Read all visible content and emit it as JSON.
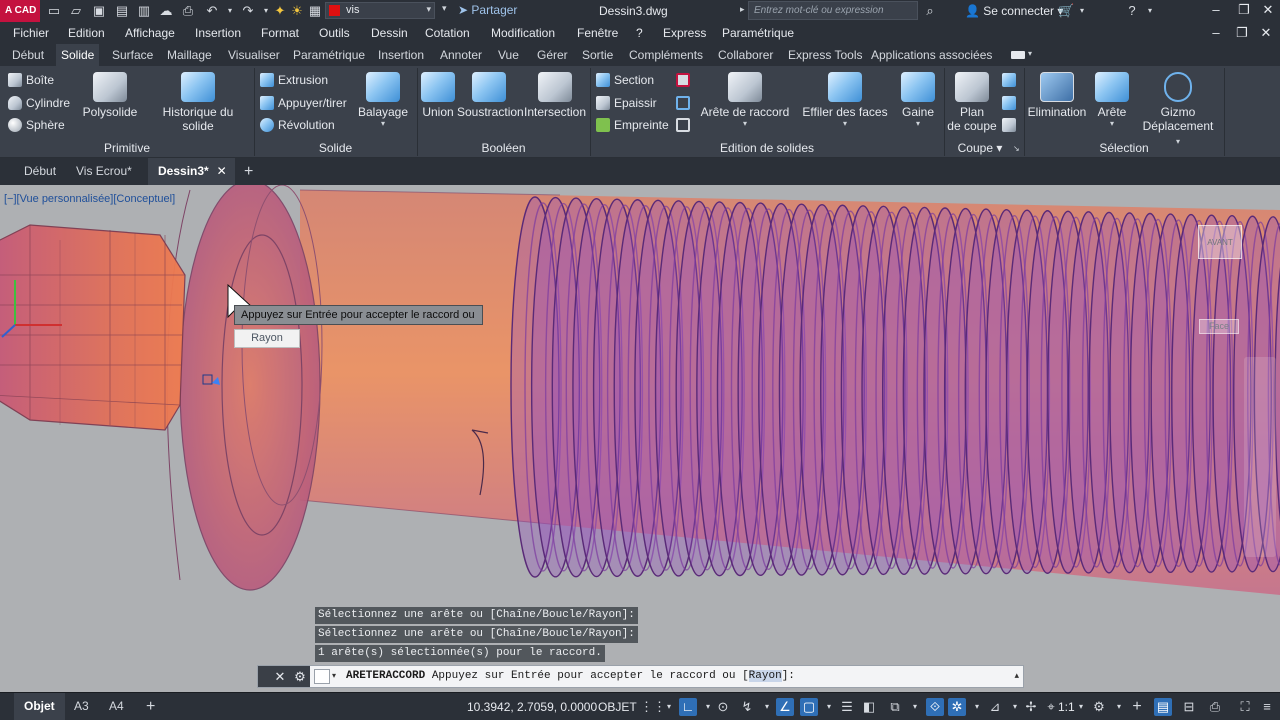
{
  "app": {
    "logo_text": "A CAD",
    "layer_name": "vis",
    "share_label": "Partager",
    "document_title": "Dessin3.dwg",
    "search_placeholder": "Entrez mot-clé ou expression",
    "signin_label": "Se connecter"
  },
  "menus": [
    "Fichier",
    "Edition",
    "Affichage",
    "Insertion",
    "Format",
    "Outils",
    "Dessin",
    "Cotation",
    "Modification",
    "Fenêtre",
    "?",
    "Express",
    "Paramétrique"
  ],
  "ribbon_tabs": [
    "Début",
    "Solide",
    "Surface",
    "Maillage",
    "Visualiser",
    "Paramétrique",
    "Insertion",
    "Annoter",
    "Vue",
    "Gérer",
    "Sortie",
    "Compléments",
    "Collaborer",
    "Express Tools",
    "Applications associées"
  ],
  "ribbon_active_tab": "Solide",
  "ribbon": {
    "primitive": {
      "title": "Primitive",
      "boite": "Boîte",
      "cylindre": "Cylindre",
      "sphere": "Sphère",
      "polysolide": "Polysolide",
      "historique": "Historique du solide"
    },
    "solide": {
      "title": "Solide",
      "extrusion": "Extrusion",
      "appuyer": "Appuyer/tirer",
      "revolution": "Révolution",
      "balayage": "Balayage"
    },
    "booleen": {
      "title": "Booléen",
      "union": "Union",
      "soustraction": "Soustraction",
      "intersection": "Intersection"
    },
    "edition": {
      "title": "Edition de solides",
      "section": "Section",
      "epaissir": "Epaissir",
      "empreinte": "Empreinte",
      "arete_raccord": "Arête de raccord",
      "effiler": "Effiler des faces",
      "gaine": "Gaine"
    },
    "coupe": {
      "title": "Coupe",
      "plan_line1": "Plan",
      "plan_line2": "de coupe"
    },
    "selection": {
      "title": "Sélection",
      "elimination": "Elimination",
      "arete": "Arête",
      "gizmo_line1": "Gizmo",
      "gizmo_line2": "Déplacement"
    }
  },
  "file_tabs": [
    "Début",
    "Vis Ecrou*",
    "Dessin3*"
  ],
  "active_file_tab": "Dessin3*",
  "viewport": {
    "view_label": "[−][Vue personnalisée][Conceptuel]",
    "tooltip": "Appuyez sur Entrée pour accepter le raccord ou",
    "tooltip_option": "Rayon",
    "viewcube_label": "AVANT",
    "face_label": "Face"
  },
  "command": {
    "history": [
      "Sélectionnez une arête ou [Chaîne/Boucle/Rayon]:",
      "Sélectionnez une arête ou [Chaîne/Boucle/Rayon]:",
      "1 arête(s) sélectionnée(s) pour le raccord."
    ],
    "name": "ARETERACCORD",
    "prompt_before": " Appuyez sur Entrée pour accepter le raccord ou [",
    "option": "Rayon",
    "prompt_after": "]:"
  },
  "status": {
    "layout_tabs": [
      "Objet",
      "A3",
      "A4"
    ],
    "active_layout": "Objet",
    "coordinates": "10.3942, 2.7059, 0.0000",
    "mode": "OBJET",
    "scale": "1:1"
  },
  "colors": {
    "accent": "#2f6fb6",
    "logo": "#c4123f",
    "viewport_bg": "#aeb0b3"
  }
}
